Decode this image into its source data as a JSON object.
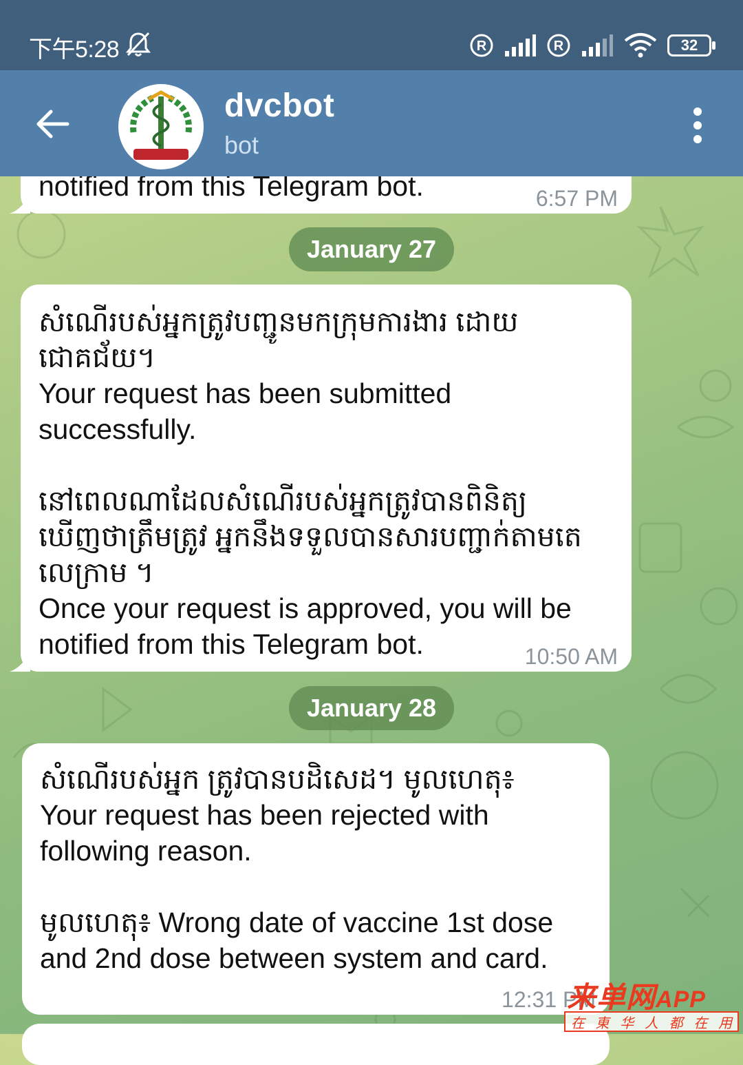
{
  "status_bar": {
    "time": "下午5:28",
    "battery": "32",
    "icons": [
      "bell-off-icon",
      "registered-icon",
      "signal-icon",
      "registered-icon",
      "signal-icon",
      "wifi-icon",
      "battery-icon"
    ]
  },
  "header": {
    "title": "dvcbot",
    "subtitle": "bot",
    "back_icon": "arrow-left-icon",
    "menu_icon": "more-vertical-icon"
  },
  "messages": [
    {
      "lines": [
        "notified from this Telegram bot."
      ],
      "time": "6:57 PM"
    },
    {
      "date": "January 27"
    },
    {
      "lines": [
        "សំណើរបស់អ្នកត្រូវបញ្ជូនមកក្រុមការងារ ដោយ",
        "ជោគជ័យ។",
        "Your request has been submitted",
        "successfully.",
        "",
        "នៅពេលណាដែលសំណើរបស់អ្នកត្រូវបានពិនិត្យ",
        "ឃើញថាត្រឹមត្រូវ អ្នកនឹងទទួលបានសារបញ្ជាក់តាមតេ",
        "លេក្រាម ។",
        "Once your request is approved, you  will be",
        "notified from this Telegram bot."
      ],
      "time": "10:50 AM"
    },
    {
      "date": "January 28"
    },
    {
      "lines": [
        "សំណើរបស់អ្នក ត្រូវបានបដិសេដ។ មូលហេតុ៖",
        "Your request has been rejected with",
        "following reason.",
        "",
        "មូលហេតុ៖ Wrong date of vaccine 1st dose",
        "and 2nd dose between system and card."
      ],
      "time": "12:31 PM"
    }
  ],
  "watermark": {
    "main": "来单网",
    "app": "APP",
    "sub": [
      "在",
      "東",
      "华",
      "人",
      "都",
      "在",
      "用"
    ]
  }
}
